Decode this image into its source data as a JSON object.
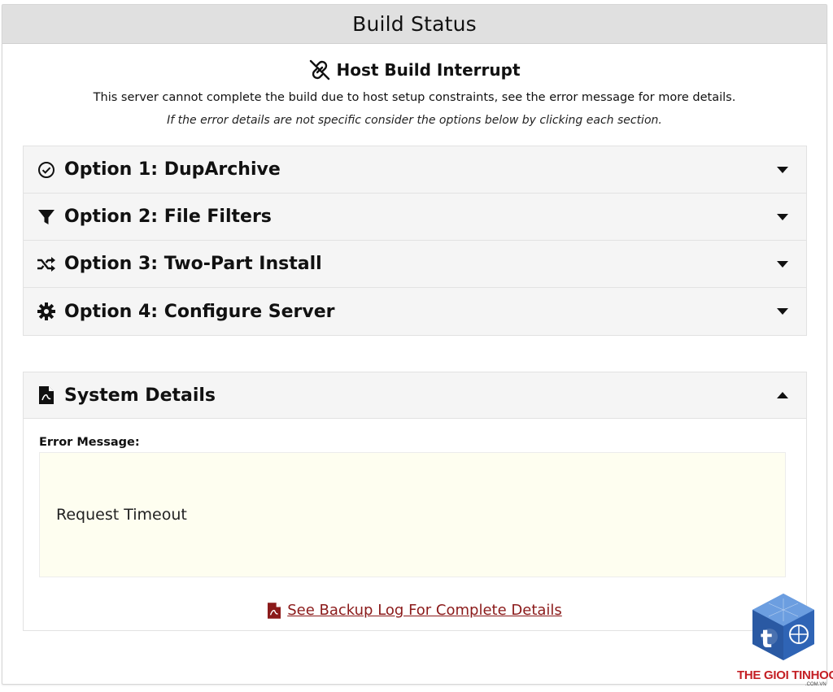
{
  "header": {
    "title": "Build Status"
  },
  "interrupt": {
    "title": "Host Build Interrupt",
    "description": "This server cannot complete the build due to host setup constraints, see the error message for more details.",
    "hint": "If the error details are not specific consider the options below by clicking each section."
  },
  "options": [
    {
      "label": "Option 1: DupArchive",
      "icon": "check-circle-icon"
    },
    {
      "label": "Option 2: File Filters",
      "icon": "filter-icon"
    },
    {
      "label": "Option 3: Two-Part Install",
      "icon": "shuffle-icon"
    },
    {
      "label": "Option 4: Configure Server",
      "icon": "gear-icon"
    }
  ],
  "system_details": {
    "title": "System Details",
    "error_label": "Error Message:",
    "error_message": "Request Timeout",
    "log_link": "See Backup Log For Complete Details"
  },
  "watermark": {
    "brand": "THE GIOI TINHOC",
    "sub": ".COM.VN"
  },
  "colors": {
    "link": "#8b1a1a",
    "error_bg": "#fefef0",
    "header_bg": "#e0e0e0",
    "brand_red": "#c41f24",
    "brand_blue": "#2f64b5"
  }
}
